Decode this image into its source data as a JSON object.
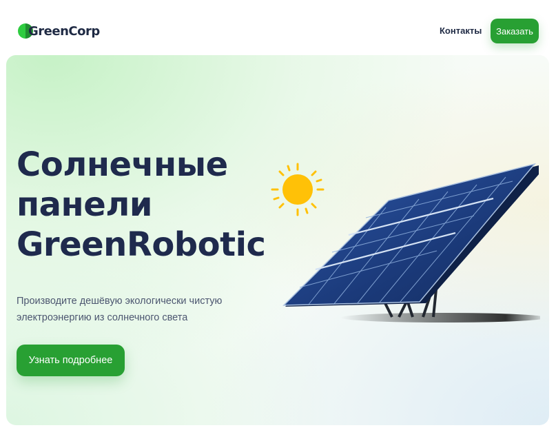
{
  "header": {
    "logo_text": "GreenCorp",
    "nav": {
      "contacts_label": "Контакты"
    },
    "order_label": "Заказать"
  },
  "hero": {
    "title_lines": [
      "Солнечные",
      "панели",
      "GreenRobotic"
    ],
    "subtitle_lines": [
      "Производите дешёвую экологически чистую",
      "электроэнергию из солнечного света"
    ],
    "cta_label": "Узнать подробнее"
  },
  "colors": {
    "accent": "#28a033",
    "title": "#1f2a4d",
    "sun": "#ffc107",
    "panel": "#1b3a7a"
  },
  "icons": {
    "logo": "leaf-circle-icon",
    "illustration_sun": "sun-icon",
    "illustration_panel": "solar-panel-icon"
  }
}
